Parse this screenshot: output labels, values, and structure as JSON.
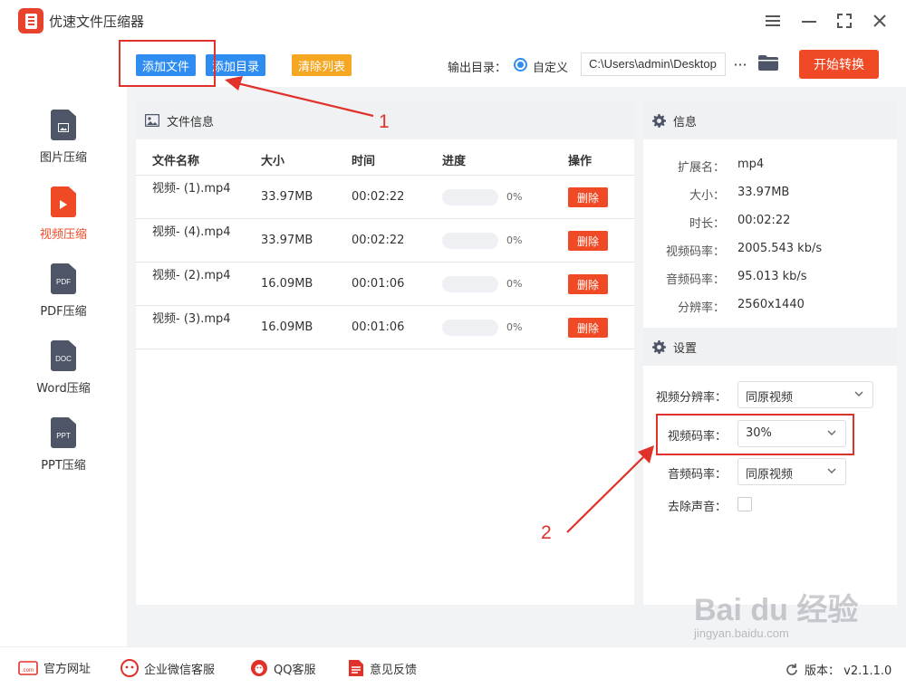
{
  "app": {
    "title": "优速文件压缩器"
  },
  "window": {
    "menu_icon": "hamburger-icon",
    "minimize_icon": "minimize-icon",
    "maximize_icon": "maximize-icon",
    "close_icon": "close-icon"
  },
  "toolbar": {
    "add_file": "添加文件",
    "add_folder": "添加目录",
    "clear_list": "清除列表",
    "output_label": "输出目录：",
    "radio_label": "自定义",
    "output_path": "C:\\Users\\admin\\Desktop",
    "dots": "···",
    "start": "开始转换"
  },
  "sidebar": {
    "items": [
      {
        "label": "图片压缩",
        "icon_text": ""
      },
      {
        "label": "视频压缩",
        "icon_text": ""
      },
      {
        "label": "PDF压缩",
        "icon_text": "PDF"
      },
      {
        "label": "Word压缩",
        "icon_text": "DOC"
      },
      {
        "label": "PPT压缩",
        "icon_text": "PPT"
      }
    ],
    "active_index": 1
  },
  "file_panel": {
    "title": "文件信息",
    "columns": {
      "name": "文件名称",
      "size": "大小",
      "time": "时间",
      "progress": "进度",
      "action": "操作"
    },
    "rows": [
      {
        "name": "视频- (1).mp4",
        "size": "33.97MB",
        "time": "00:02:22",
        "progress": 0,
        "pct": "0%",
        "delete": "删除"
      },
      {
        "name": "视频- (4).mp4",
        "size": "33.97MB",
        "time": "00:02:22",
        "progress": 0,
        "pct": "0%",
        "delete": "删除"
      },
      {
        "name": "视频- (2).mp4",
        "size": "16.09MB",
        "time": "00:01:06",
        "progress": 0,
        "pct": "0%",
        "delete": "删除"
      },
      {
        "name": "视频- (3).mp4",
        "size": "16.09MB",
        "time": "00:01:06",
        "progress": 0,
        "pct": "0%",
        "delete": "删除"
      }
    ]
  },
  "info_panel": {
    "title": "信息",
    "rows": [
      {
        "key": "扩展名：",
        "value": "mp4"
      },
      {
        "key": "大小：",
        "value": "33.97MB"
      },
      {
        "key": "时长：",
        "value": "00:02:22"
      },
      {
        "key": "视频码率：",
        "value": "2005.543 kb/s"
      },
      {
        "key": "音频码率：",
        "value": "95.013 kb/s"
      },
      {
        "key": "分辨率：",
        "value": "2560x1440"
      }
    ]
  },
  "settings": {
    "title": "设置",
    "video_resolution_label": "视频分辨率：",
    "video_resolution_value": "同原视频",
    "video_bitrate_label": "视频码率：",
    "video_bitrate_value": "30%",
    "audio_bitrate_label": "音频码率：",
    "audio_bitrate_value": "同原视频",
    "remove_audio_label": "去除声音：",
    "remove_audio_checked": false
  },
  "footer": {
    "website": "官方网址",
    "wechat": "企业微信客服",
    "qq": "QQ客服",
    "feedback": "意见反馈",
    "version": "版本： v2.1.1.0"
  },
  "annotations": {
    "one": "1",
    "two": "2"
  },
  "watermark": {
    "brand": "Bai du 经验",
    "url": "jingyan.baidu.com"
  },
  "colors": {
    "accent_red": "#ef4a25",
    "accent_blue": "#2f8cf0",
    "accent_orange": "#f5a623",
    "annotation_red": "#e0322b"
  }
}
